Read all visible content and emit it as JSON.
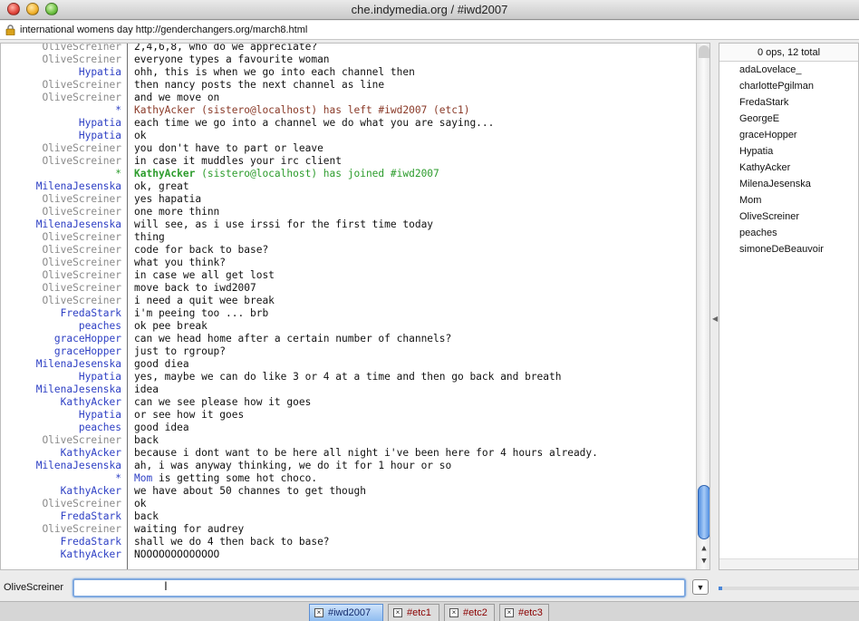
{
  "window": {
    "title": "che.indymedia.org / #iwd2007"
  },
  "topic": {
    "text": "international womens day http://genderchangers.org/march8.html"
  },
  "chat": {
    "lines": [
      {
        "nick": "OliveScreiner",
        "kind": "grey",
        "msg": "2,4,6,8, who do we appreciate?"
      },
      {
        "nick": "OliveScreiner",
        "kind": "grey",
        "msg": "everyone types a favourite woman"
      },
      {
        "nick": "Hypatia",
        "kind": "blue",
        "msg": "ohh, this is when we go into each channel then"
      },
      {
        "nick": "OliveScreiner",
        "kind": "grey",
        "msg": "then nancy posts the next channel as line"
      },
      {
        "nick": "OliveScreiner",
        "kind": "grey",
        "msg": "and we move on"
      },
      {
        "nick": "*",
        "kind": "left",
        "who": "KathyAcker",
        "msg": " (sistero@localhost) has left #iwd2007 (etc1)"
      },
      {
        "nick": "Hypatia",
        "kind": "blue",
        "msg": "each time we go into a channel we do what you are saying..."
      },
      {
        "nick": "Hypatia",
        "kind": "blue",
        "msg": "ok"
      },
      {
        "nick": "OliveScreiner",
        "kind": "grey",
        "msg": "you don't have to part or leave"
      },
      {
        "nick": "OliveScreiner",
        "kind": "grey",
        "msg": "in case it muddles your irc client"
      },
      {
        "nick": "*",
        "kind": "join",
        "who": "KathyAcker",
        "msg": " (sistero@localhost) has joined #iwd2007"
      },
      {
        "nick": "MilenaJesenska",
        "kind": "blue",
        "msg": "ok, great"
      },
      {
        "nick": "OliveScreiner",
        "kind": "grey",
        "msg": "yes hapatia"
      },
      {
        "nick": "OliveScreiner",
        "kind": "grey",
        "msg": "one more thinn"
      },
      {
        "nick": "MilenaJesenska",
        "kind": "blue",
        "msg": "will see, as i use irssi for the first time today"
      },
      {
        "nick": "OliveScreiner",
        "kind": "grey",
        "msg": "thing"
      },
      {
        "nick": "OliveScreiner",
        "kind": "grey",
        "msg": "code for back to base?"
      },
      {
        "nick": "OliveScreiner",
        "kind": "grey",
        "msg": "what you think?"
      },
      {
        "nick": "OliveScreiner",
        "kind": "grey",
        "msg": "in case we all get lost"
      },
      {
        "nick": "OliveScreiner",
        "kind": "grey",
        "msg": "move back to iwd2007"
      },
      {
        "nick": "OliveScreiner",
        "kind": "grey",
        "msg": "i need a quit wee break"
      },
      {
        "nick": "FredaStark",
        "kind": "blue",
        "msg": "i'm peeing too ... brb"
      },
      {
        "nick": "peaches",
        "kind": "blue",
        "msg": "ok pee break"
      },
      {
        "nick": "graceHopper",
        "kind": "blue",
        "msg": "can we head home after a certain number of channels?"
      },
      {
        "nick": "graceHopper",
        "kind": "blue",
        "msg": "just to rgroup?"
      },
      {
        "nick": "MilenaJesenska",
        "kind": "blue",
        "msg": "good diea"
      },
      {
        "nick": "Hypatia",
        "kind": "blue",
        "msg": "yes, maybe we can do like 3 or 4 at a time and then go back and breath"
      },
      {
        "nick": "MilenaJesenska",
        "kind": "blue",
        "msg": "idea"
      },
      {
        "nick": "KathyAcker",
        "kind": "blue",
        "msg": "can we see please how it goes"
      },
      {
        "nick": "Hypatia",
        "kind": "blue",
        "msg": "or see how it goes"
      },
      {
        "nick": "peaches",
        "kind": "blue",
        "msg": "good idea"
      },
      {
        "nick": "OliveScreiner",
        "kind": "grey",
        "msg": "back"
      },
      {
        "nick": "KathyAcker",
        "kind": "blue",
        "msg": "because i dont want to be here all night i've been here for 4 hours already."
      },
      {
        "nick": "MilenaJesenska",
        "kind": "blue",
        "msg": "ah, i was anyway thinking, we do it for 1 hour or so"
      },
      {
        "nick": "*",
        "kind": "act",
        "who": "Mom",
        "msg": " is getting some hot choco."
      },
      {
        "nick": "KathyAcker",
        "kind": "blue",
        "msg": "we have about 50 channes to get though"
      },
      {
        "nick": "OliveScreiner",
        "kind": "grey",
        "msg": "ok"
      },
      {
        "nick": "FredaStark",
        "kind": "blue",
        "msg": "back"
      },
      {
        "nick": "OliveScreiner",
        "kind": "grey",
        "msg": "waiting for audrey"
      },
      {
        "nick": "FredaStark",
        "kind": "blue",
        "msg": "shall we do 4 then back to base?"
      },
      {
        "nick": "KathyAcker",
        "kind": "blue",
        "msg": "NOOOOOOOOOOOOO"
      }
    ]
  },
  "userlist": {
    "header": "0 ops, 12 total",
    "users": [
      "adaLovelace_",
      "charlottePgilman",
      "FredaStark",
      "GeorgeE",
      "graceHopper",
      "Hypatia",
      "KathyAcker",
      "MilenaJesenska",
      "Mom",
      "OliveScreiner",
      "peaches",
      "simoneDeBeauvoir"
    ]
  },
  "input": {
    "nick": "OliveScreiner",
    "value": "",
    "placeholder": ""
  },
  "tabs": [
    {
      "label": "#iwd2007",
      "active": true
    },
    {
      "label": "#etc1",
      "active": false
    },
    {
      "label": "#etc2",
      "active": false
    },
    {
      "label": "#etc3",
      "active": false
    }
  ],
  "colors": {
    "nick_blue": "#2d3fc4",
    "nick_grey": "#8a8a8a",
    "join_green": "#2c9c2c",
    "part_brown": "#8a3a28",
    "tab_inactive": "#8b0000"
  }
}
